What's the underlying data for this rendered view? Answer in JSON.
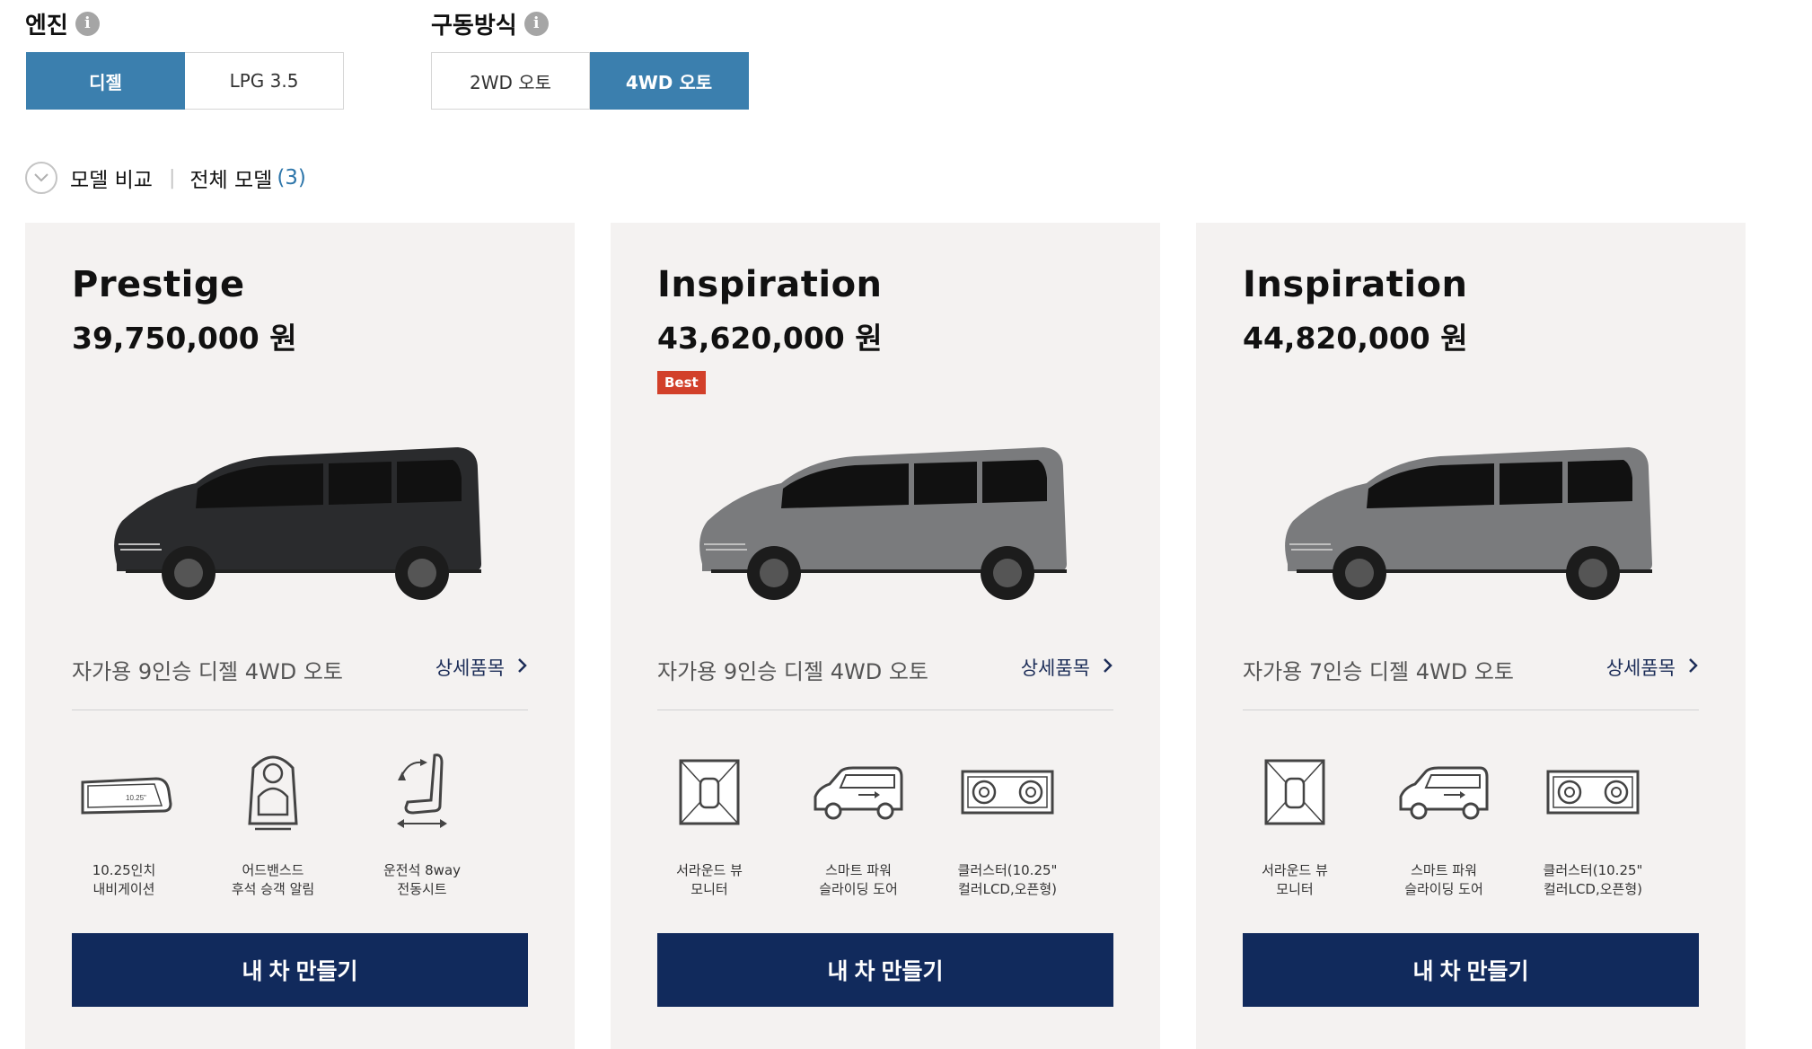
{
  "filters": {
    "engine": {
      "label": "엔진",
      "options": [
        "디젤",
        "LPG 3.5"
      ],
      "selected": "디젤"
    },
    "drive": {
      "label": "구동방식",
      "options": [
        "2WD 오토",
        "4WD 오토"
      ],
      "selected": "4WD 오토"
    }
  },
  "compare": {
    "label": "모델 비교",
    "all_models_label": "전체 모델",
    "all_models_count": "(3)"
  },
  "cards": [
    {
      "name": "Prestige",
      "price": "39,750,000 원",
      "badge": "",
      "car_color": "#2a2b2d",
      "description": "자가용 9인승 디젤 4WD 오토",
      "detail_link": "상세품목",
      "features": [
        {
          "icon": "navigation-screen-icon",
          "line1": "10.25인치",
          "line2": "내비게이션",
          "screen_label": "10.25\""
        },
        {
          "icon": "rear-seat-alert-icon",
          "line1": "어드밴스드",
          "line2": "후석 승객 알림"
        },
        {
          "icon": "power-seat-icon",
          "line1": "운전석 8way",
          "line2": "전동시트"
        }
      ],
      "button": "내 차 만들기"
    },
    {
      "name": "Inspiration",
      "price": "43,620,000 원",
      "badge": "Best",
      "car_color": "#7a7b7d",
      "description": "자가용 9인승 디젤 4WD 오토",
      "detail_link": "상세품목",
      "features": [
        {
          "icon": "surround-view-monitor-icon",
          "line1": "서라운드 뷰",
          "line2": "모니터"
        },
        {
          "icon": "power-sliding-door-icon",
          "line1": "스마트 파워",
          "line2": "슬라이딩 도어"
        },
        {
          "icon": "cluster-lcd-icon",
          "line1": "클러스터(10.25\"",
          "line2": "컬러LCD,오픈형)"
        }
      ],
      "button": "내 차 만들기"
    },
    {
      "name": "Inspiration",
      "price": "44,820,000 원",
      "badge": "",
      "car_color": "#7a7b7d",
      "description": "자가용 7인승 디젤 4WD 오토",
      "detail_link": "상세품목",
      "features": [
        {
          "icon": "surround-view-monitor-icon",
          "line1": "서라운드 뷰",
          "line2": "모니터"
        },
        {
          "icon": "power-sliding-door-icon",
          "line1": "스마트 파워",
          "line2": "슬라이딩 도어"
        },
        {
          "icon": "cluster-lcd-icon",
          "line1": "클러스터(10.25\"",
          "line2": "컬러LCD,오픈형)"
        }
      ],
      "button": "내 차 만들기"
    }
  ]
}
